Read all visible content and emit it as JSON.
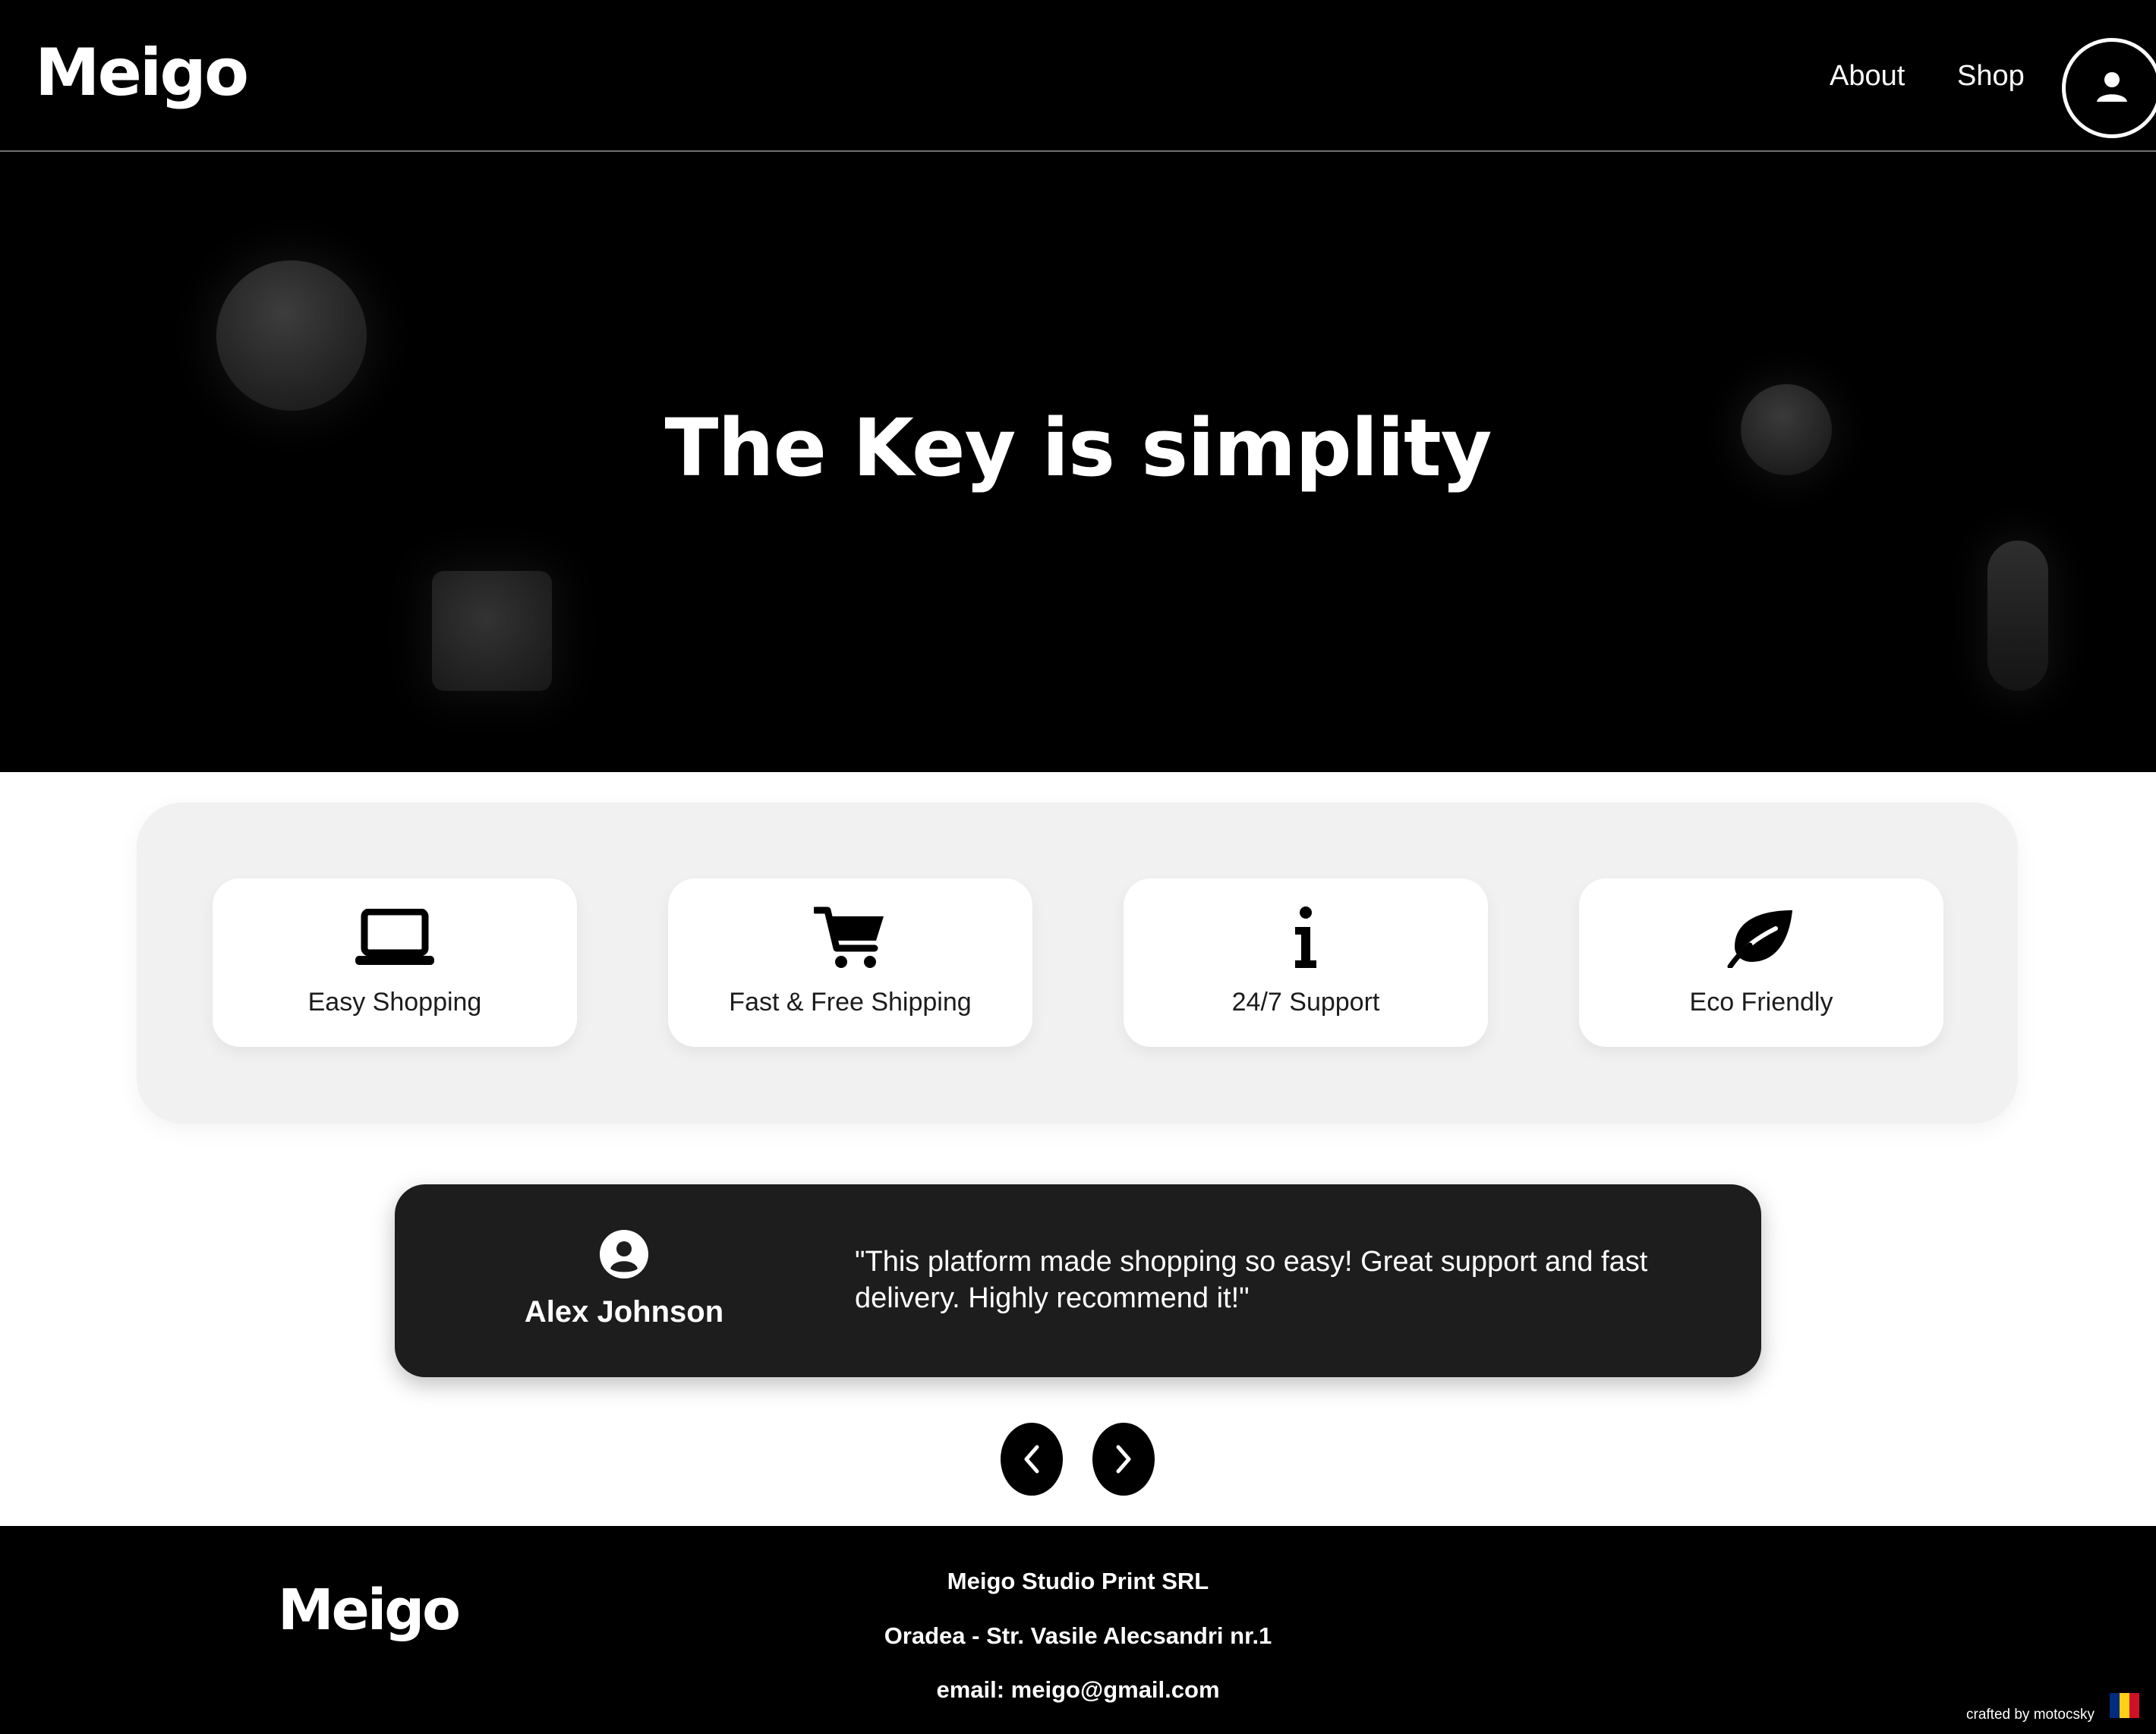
{
  "header": {
    "logo": "Meigo",
    "nav": {
      "about": "About",
      "shop": "Shop"
    },
    "user_icon": "user-circle-icon"
  },
  "hero": {
    "title": "The Key is simplity"
  },
  "features": [
    {
      "label": "Easy Shopping",
      "icon": "laptop-icon"
    },
    {
      "label": "Fast & Free Shipping",
      "icon": "cart-icon"
    },
    {
      "label": "24/7 Support",
      "icon": "info-icon"
    },
    {
      "label": "Eco Friendly",
      "icon": "leaf-icon"
    }
  ],
  "testimonial": {
    "avatar_icon": "user-circle-icon",
    "name": "Alex Johnson",
    "quote": "\"This platform made shopping so easy! Great support and fast delivery. Highly recommend it!\""
  },
  "carousel": {
    "prev_icon": "chevron-left-icon",
    "next_icon": "chevron-right-icon"
  },
  "footer": {
    "logo": "Meigo",
    "company": "Meigo Studio Print SRL",
    "address": "Oradea - Str. Vasile Alecsandri nr.1",
    "email": "email: meigo@gmail.com",
    "credit": "crafted by motocsky",
    "flag_colors": [
      "#002b7f",
      "#fcd116",
      "#ce1126"
    ]
  },
  "colors": {
    "background_dark": "#000000",
    "panel": "#f2f1f1",
    "testimonial_bg": "#1d1d1d",
    "text_light": "#ffffff"
  }
}
